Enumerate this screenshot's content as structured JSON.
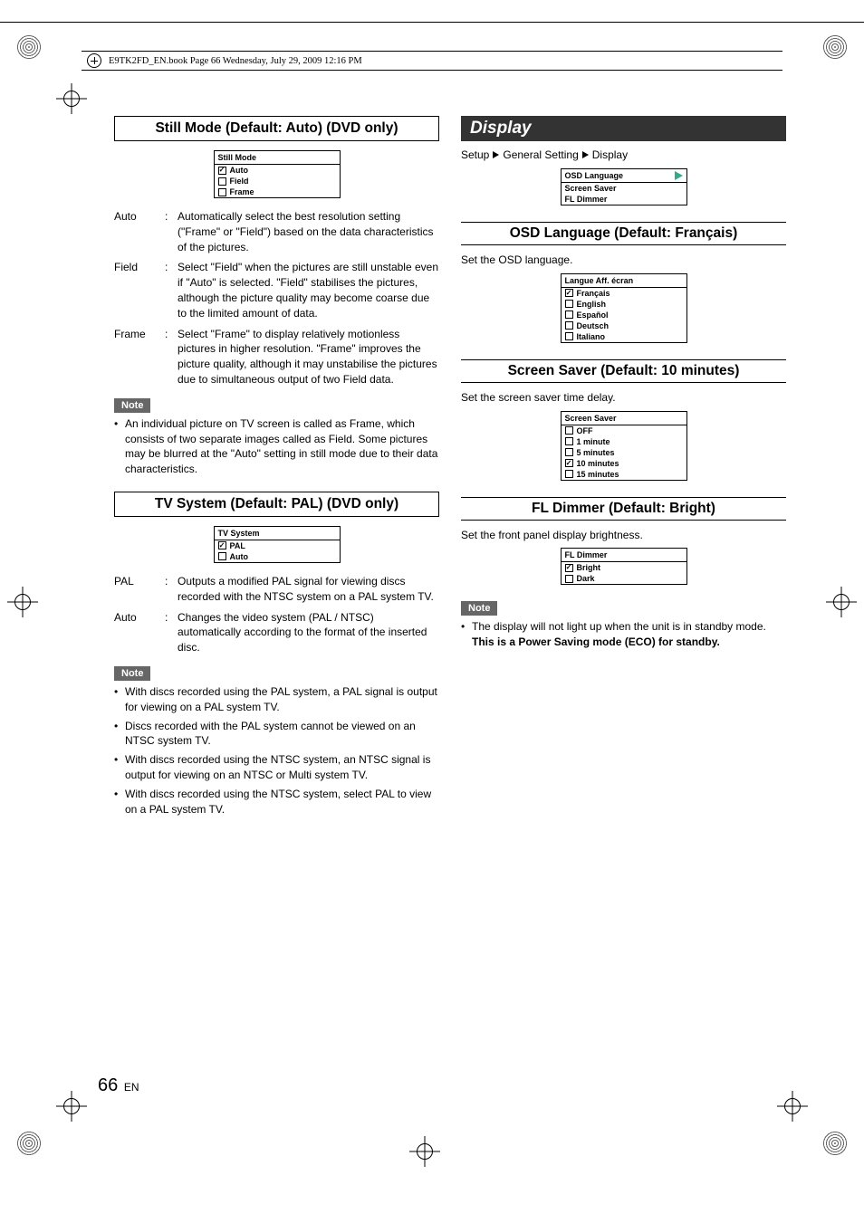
{
  "header": "E9TK2FD_EN.book  Page 66  Wednesday, July 29, 2009  12:16 PM",
  "page": {
    "number": "66",
    "lang": "EN"
  },
  "left": {
    "still_mode": {
      "heading": "Still Mode (Default: Auto) (DVD only)",
      "menu": {
        "title": "Still Mode",
        "items": [
          {
            "label": "Auto",
            "checked": true
          },
          {
            "label": "Field",
            "checked": false
          },
          {
            "label": "Frame",
            "checked": false
          }
        ]
      },
      "defs": [
        {
          "term": "Auto",
          "body": "Automatically select the best resolution setting (\"Frame\" or \"Field\") based on the data characteristics of the pictures."
        },
        {
          "term": "Field",
          "body": "Select \"Field\" when the pictures are still unstable even if \"Auto\" is selected. \"Field\" stabilises the pictures, although the picture quality may become coarse due to the limited amount of data."
        },
        {
          "term": "Frame",
          "body": "Select \"Frame\" to display relatively motionless pictures in higher resolution. \"Frame\" improves the picture quality, although it may unstabilise the pictures due to simultaneous output of two Field data."
        }
      ],
      "note_label": "Note",
      "notes": [
        "An individual picture on TV screen is called as Frame, which consists of two separate images called as Field. Some pictures may be blurred at the \"Auto\" setting in still mode due to their data characteristics."
      ]
    },
    "tv_system": {
      "heading": "TV System (Default: PAL) (DVD only)",
      "menu": {
        "title": "TV System",
        "items": [
          {
            "label": "PAL",
            "checked": true
          },
          {
            "label": "Auto",
            "checked": false
          }
        ]
      },
      "defs": [
        {
          "term": "PAL",
          "body": "Outputs a modified PAL signal for viewing discs recorded with the NTSC system on a PAL system TV."
        },
        {
          "term": "Auto",
          "body": "Changes the video system (PAL / NTSC) automatically according to the format of the inserted disc."
        }
      ],
      "note_label": "Note",
      "notes": [
        "With discs recorded using the PAL system, a PAL signal is output for viewing on a PAL system TV.",
        "Discs recorded with the PAL system cannot be viewed on an NTSC system TV.",
        "With discs recorded using the NTSC system, an NTSC signal is output for viewing on an NTSC or Multi system TV.",
        "With discs recorded using the NTSC system, select PAL to view on a PAL system TV."
      ]
    }
  },
  "right": {
    "display_heading": "Display",
    "breadcrumb": [
      "Setup",
      "General Setting",
      "Display"
    ],
    "display_menu": {
      "items": [
        "OSD Language",
        "Screen Saver",
        "FL Dimmer"
      ]
    },
    "osd_lang": {
      "heading": "OSD Language (Default: Français)",
      "intro": "Set the OSD language.",
      "menu": {
        "title": "Langue Aff. écran",
        "items": [
          {
            "label": "Français",
            "checked": true
          },
          {
            "label": "English",
            "checked": false
          },
          {
            "label": "Español",
            "checked": false
          },
          {
            "label": "Deutsch",
            "checked": false
          },
          {
            "label": "Italiano",
            "checked": false
          }
        ]
      }
    },
    "screen_saver": {
      "heading": "Screen Saver (Default: 10 minutes)",
      "intro": "Set the screen saver time delay.",
      "menu": {
        "title": "Screen Saver",
        "items": [
          {
            "label": "OFF",
            "checked": false
          },
          {
            "label": "1 minute",
            "checked": false
          },
          {
            "label": "5 minutes",
            "checked": false
          },
          {
            "label": "10 minutes",
            "checked": true
          },
          {
            "label": "15 minutes",
            "checked": false
          }
        ]
      }
    },
    "fl_dimmer": {
      "heading": "FL Dimmer (Default: Bright)",
      "intro": "Set the front panel display brightness.",
      "menu": {
        "title": "FL Dimmer",
        "items": [
          {
            "label": "Bright",
            "checked": true
          },
          {
            "label": "Dark",
            "checked": false
          }
        ]
      },
      "note_label": "Note",
      "note_text": "The display will not light up when the unit is in standby mode. ",
      "note_bold": "This is a Power Saving mode (ECO) for standby."
    }
  }
}
